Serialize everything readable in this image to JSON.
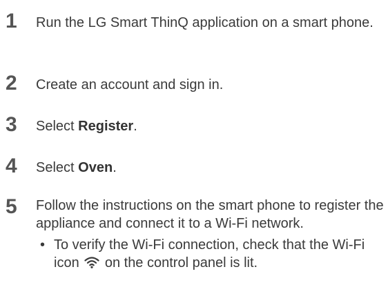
{
  "steps": [
    {
      "number": "1",
      "text": "Run the LG Smart ThinQ application on a smart phone."
    },
    {
      "number": "2",
      "text": "Create an account and sign in."
    },
    {
      "number": "3",
      "prefix": "Select ",
      "bold": "Register",
      "suffix": "."
    },
    {
      "number": "4",
      "prefix": "Select ",
      "bold": "Oven",
      "suffix": "."
    },
    {
      "number": "5",
      "text": "Follow the instructions on the smart phone to register the appliance and connect it to a Wi-Fi network."
    }
  ],
  "note": {
    "bullet": "•",
    "before_icon": "To verify the Wi-Fi connection, check that the Wi-Fi icon",
    "icon": "wifi-icon",
    "after_icon": "on the control panel is lit."
  }
}
